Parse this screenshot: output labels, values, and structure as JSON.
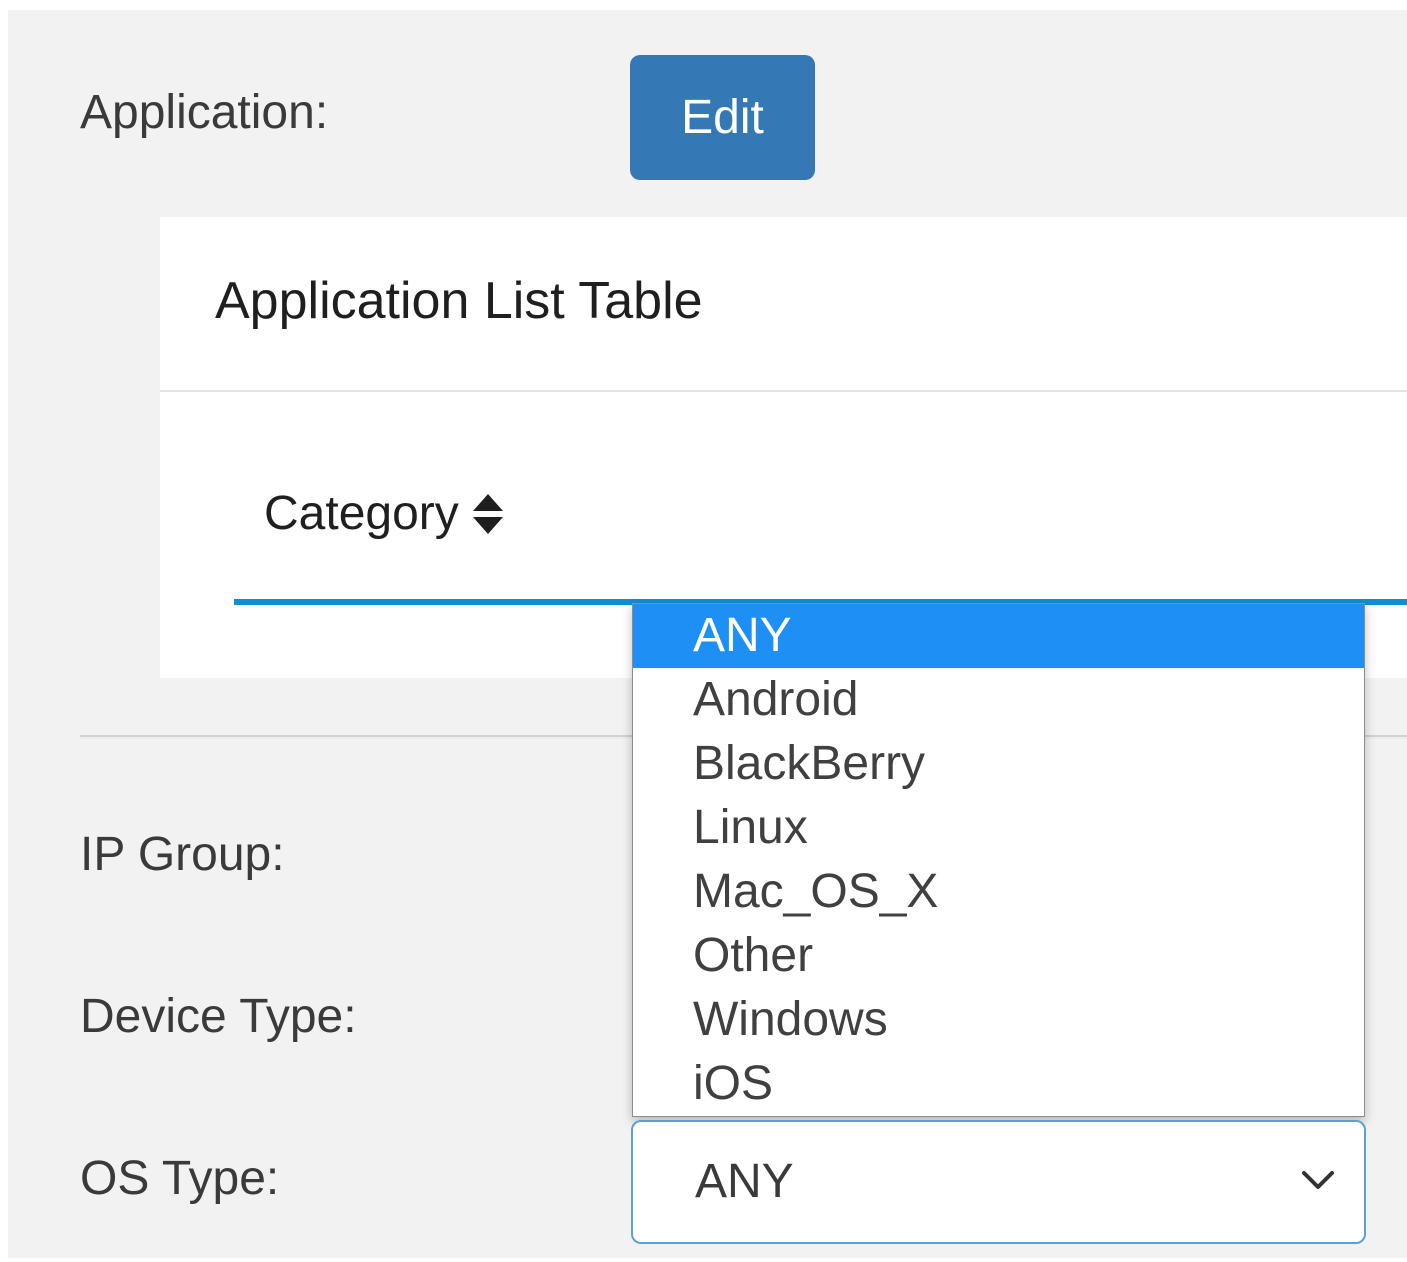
{
  "form": {
    "application_label": "Application:",
    "edit_button_label": "Edit",
    "ip_group_label": "IP Group:",
    "device_type_label": "Device Type:",
    "os_type_label": "OS Type:"
  },
  "application_table": {
    "title": "Application List Table",
    "columns": [
      {
        "label": "Category",
        "sortable": true
      }
    ]
  },
  "os_type_select": {
    "selected_value": "ANY",
    "options": [
      "ANY",
      "Android",
      "BlackBerry",
      "Linux",
      "Mac_OS_X",
      "Other",
      "Windows",
      "iOS"
    ],
    "highlighted_option": "ANY",
    "expanded": true
  },
  "colors": {
    "page_background": "#f2f2f2",
    "primary_button": "#3478b6",
    "table_header_underline": "#0d90d1",
    "option_highlight": "#1e8ff5",
    "focus_border": "#5ba0d8"
  },
  "icons": {
    "sort": "sort-icon",
    "select_chevron": "chevron-down-icon"
  }
}
